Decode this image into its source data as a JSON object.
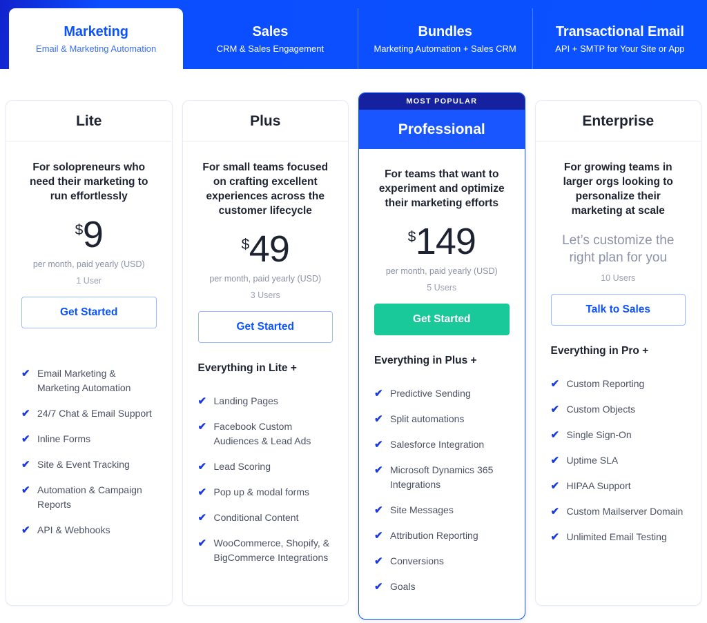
{
  "theme": {
    "brand_blue": "#0b52ff",
    "navy": "#15219e",
    "green": "#1ac99a",
    "check_blue": "#1a3ae0",
    "text_dark": "#1d2330",
    "text_muted": "#8b92a5"
  },
  "tabs": [
    {
      "title": "Marketing",
      "subtitle": "Email & Marketing Automation",
      "active": true
    },
    {
      "title": "Sales",
      "subtitle": "CRM & Sales Engagement",
      "active": false
    },
    {
      "title": "Bundles",
      "subtitle": "Marketing Automation + Sales CRM",
      "active": false
    },
    {
      "title": "Transactional Email",
      "subtitle": "API + SMTP for Your Site or App",
      "active": false
    }
  ],
  "plans": [
    {
      "name": "Lite",
      "description": "For solopreneurs who need their marketing to run effortlessly",
      "currency": "$",
      "amount": "9",
      "price_note": "per month, paid yearly (USD)",
      "users": "1 User",
      "cta_label": "Get Started",
      "everything": "",
      "features": [
        "Email Marketing & Marketing Automation",
        "24/7 Chat & Email Support",
        "Inline Forms",
        "Site & Event Tracking",
        "Automation & Campaign Reports",
        "API & Webhooks"
      ]
    },
    {
      "name": "Plus",
      "description": "For small teams focused on crafting excellent experiences across the customer lifecycle",
      "currency": "$",
      "amount": "49",
      "price_note": "per month, paid yearly (USD)",
      "users": "3 Users",
      "cta_label": "Get Started",
      "everything": "Everything in Lite +",
      "features": [
        "Landing Pages",
        "Facebook Custom Audiences & Lead Ads",
        "Lead Scoring",
        "Pop up & modal forms",
        "Conditional Content",
        "WooCommerce, Shopify, & BigCommerce Integrations"
      ]
    },
    {
      "name": "Professional",
      "badge": "MOST POPULAR",
      "description": "For teams that want to experiment and optimize their marketing efforts",
      "currency": "$",
      "amount": "149",
      "price_note": "per month, paid yearly (USD)",
      "users": "5 Users",
      "cta_label": "Get Started",
      "everything": "Everything in Plus +",
      "features": [
        "Predictive Sending",
        "Split automations",
        "Salesforce Integration",
        "Microsoft Dynamics 365 Integrations",
        "Site Messages",
        "Attribution Reporting",
        "Conversions",
        "Goals"
      ]
    },
    {
      "name": "Enterprise",
      "description": "For growing teams in larger orgs looking to personalize their marketing at scale",
      "custom_price": "Let’s customize the right plan for you",
      "users": "10 Users",
      "cta_label": "Talk to Sales",
      "everything": "Everything in Pro +",
      "features": [
        "Custom Reporting",
        "Custom Objects",
        "Single Sign-On",
        "Uptime SLA",
        "HIPAA Support",
        "Custom Mailserver Domain",
        "Unlimited Email Testing"
      ]
    }
  ]
}
